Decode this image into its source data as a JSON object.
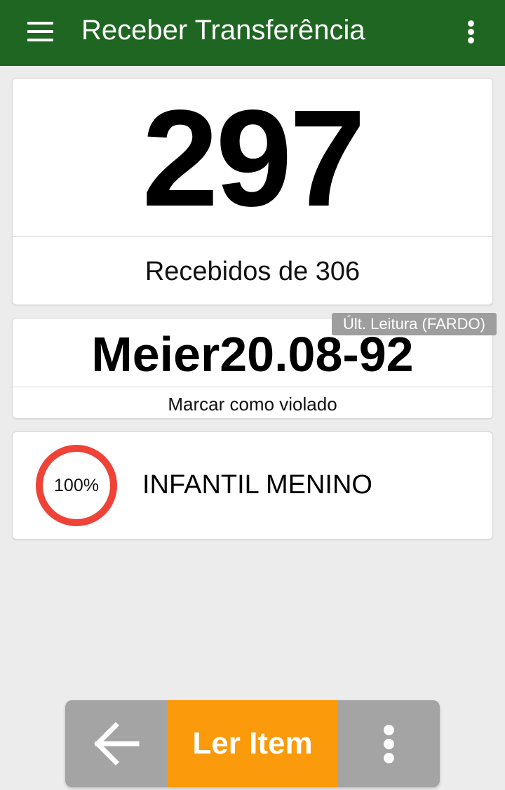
{
  "header": {
    "title": "Receber Transferência",
    "menu_icon": "hamburger-menu-icon",
    "overflow_icon": "more-vertical-icon",
    "color": "#1f6622"
  },
  "counter": {
    "received": "297",
    "label": "Recebidos de 306"
  },
  "last_read": {
    "tag": "Últ. Leitura (FARDO)",
    "code": "Meier20.08-92",
    "violate_action": "Marcar como violado"
  },
  "category": {
    "progress_label": "100%",
    "progress_value": 1.0,
    "progress_color": "#ef4337",
    "name": "INFANTIL MENINO"
  },
  "bottom_bar": {
    "back_icon": "arrow-left-icon",
    "read_label": "Ler Item",
    "read_color": "#fb9a0a",
    "more_icon": "more-vertical-icon"
  }
}
